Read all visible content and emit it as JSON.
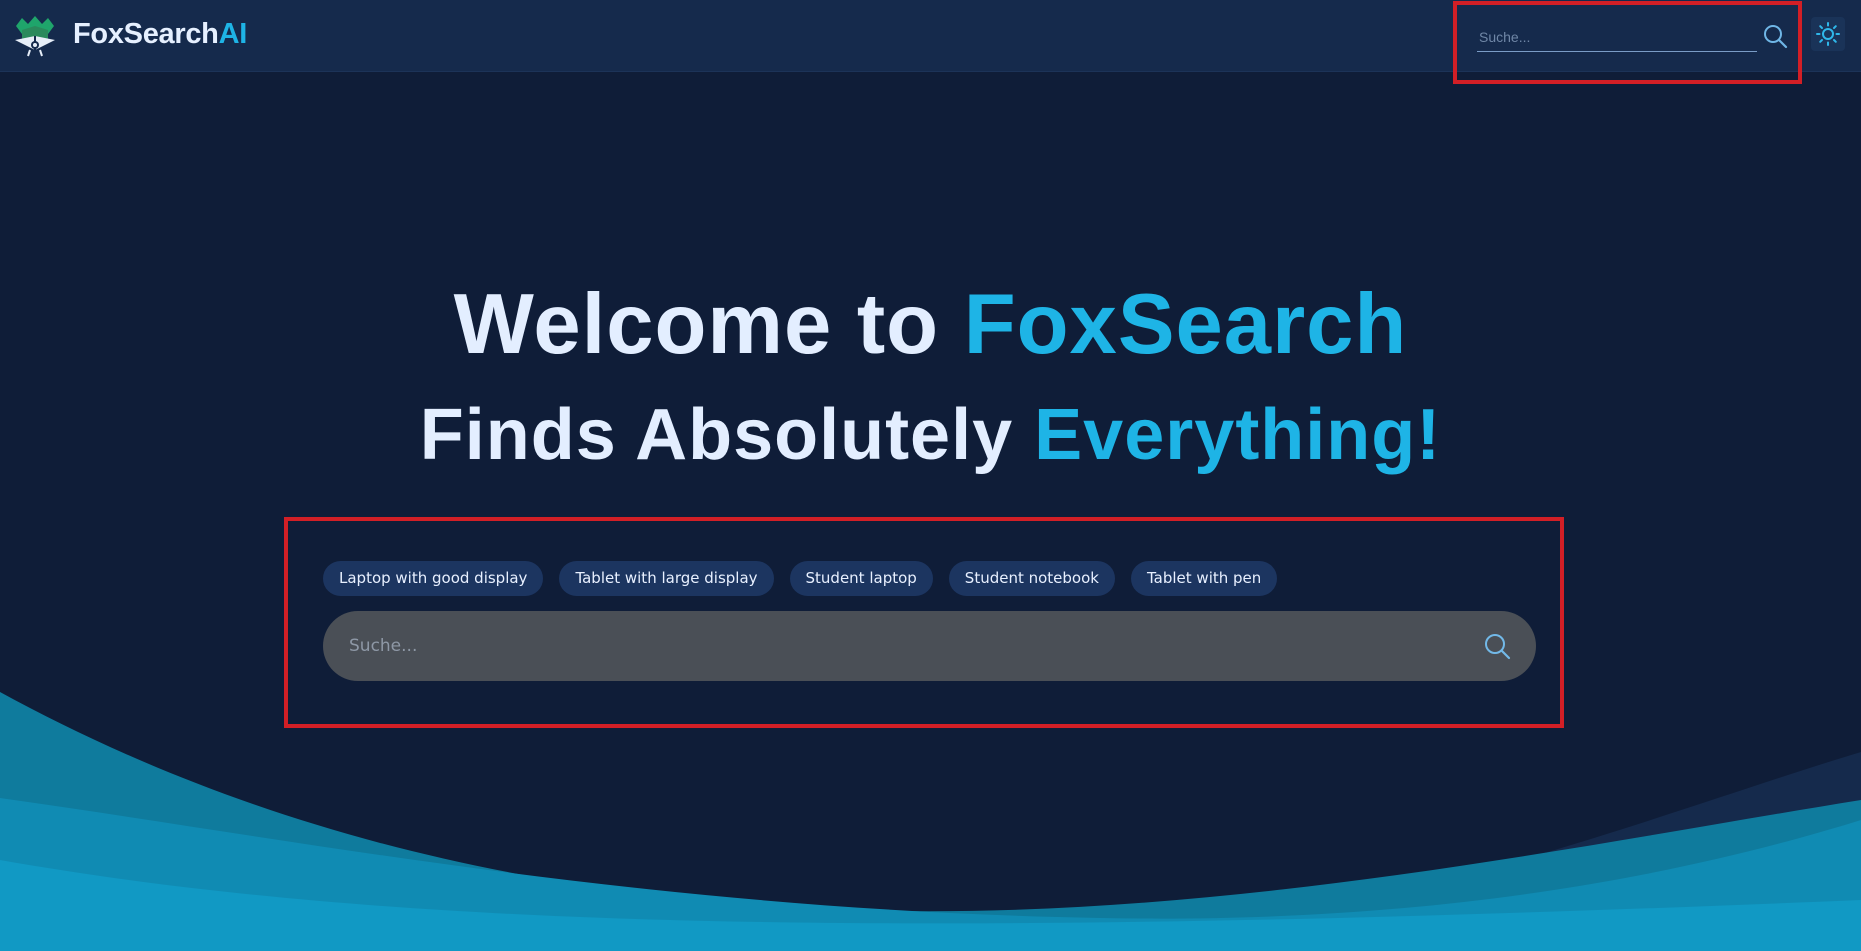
{
  "header": {
    "brand_main": "FoxSearch",
    "brand_accent": "AI",
    "search_placeholder": "Suche...",
    "logo_icon": "fox-book-icon",
    "search_icon": "search-icon",
    "theme_icon": "sun-icon"
  },
  "hero": {
    "line1_main": "Welcome to ",
    "line1_accent": "FoxSearch",
    "line2_main": "Finds Absolutely ",
    "line2_accent": "Everything!"
  },
  "suggestions": [
    "Laptop with good display",
    "Tablet with large display",
    "Student laptop",
    "Student notebook",
    "Tablet with pen"
  ],
  "search": {
    "placeholder": "Suche..."
  },
  "colors": {
    "background": "#0f1d38",
    "header": "#152a4c",
    "accent": "#1eb4e6",
    "highlight_border": "#d21f26",
    "search_bar": "#4a4f56"
  }
}
